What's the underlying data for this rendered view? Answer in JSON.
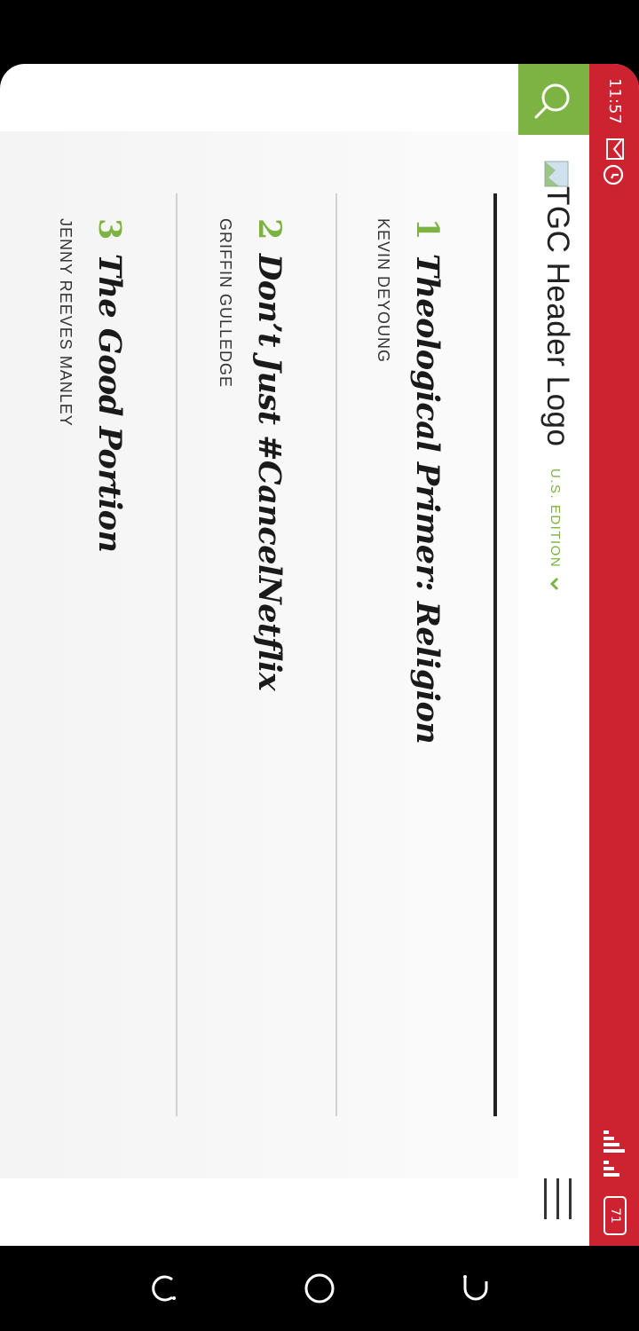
{
  "status_bar": {
    "time": "11:57",
    "battery": "71",
    "icons": [
      "mail-icon",
      "alarm-icon",
      "signal-icon",
      "battery-icon"
    ]
  },
  "header": {
    "logo_alt": "TGC Header Logo",
    "edition": "U.S. EDITION",
    "icons": [
      "search-icon",
      "broken-image-icon",
      "chevron-down-icon",
      "hamburger-menu-icon"
    ]
  },
  "articles": [
    {
      "number": "1",
      "title": "Theological Primer: Religion",
      "author": "KEVIN DEYOUNG"
    },
    {
      "number": "2",
      "title": "Don’t Just #CancelNetflix",
      "author": "GRIFFIN GULLEDGE"
    },
    {
      "number": "3",
      "title": "The Good Portion",
      "author": "JENNY REEVES MANLEY"
    }
  ],
  "nav_bar": {
    "icons": [
      "recent-apps-icon",
      "home-icon",
      "back-icon"
    ]
  },
  "colors": {
    "status_bar": "#cd2330",
    "accent_green": "#7cb342",
    "title_text": "#1a1a1a"
  }
}
